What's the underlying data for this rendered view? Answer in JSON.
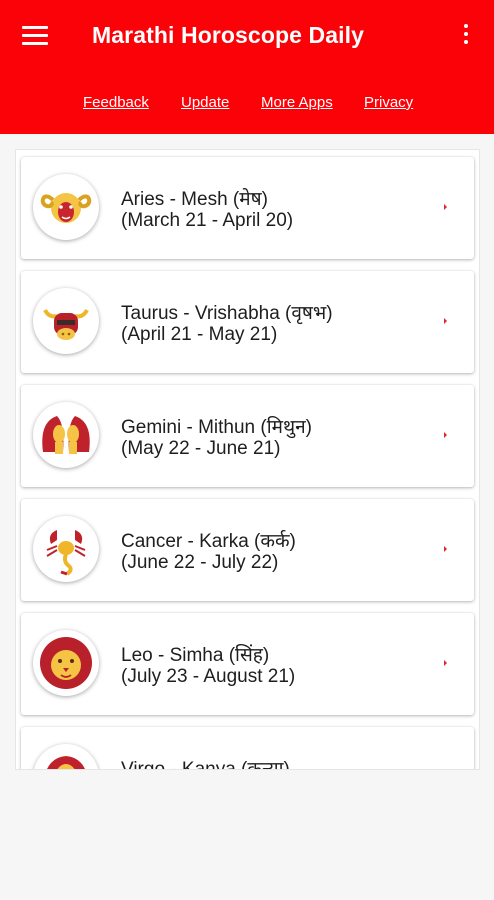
{
  "app": {
    "title": "Marathi Horoscope Daily",
    "accent_color": "#fb0208",
    "menu_icon": "hamburger-menu-icon",
    "overflow_icon": "more-vertical-icon"
  },
  "links": {
    "feedback": "Feedback",
    "update": "Update",
    "more_apps": "More Apps",
    "privacy": "Privacy"
  },
  "signs": [
    {
      "name": "Aries - Mesh (मेष)",
      "dates": "(March 21 - April 20)",
      "icon": "aries-ram-icon"
    },
    {
      "name": "Taurus - Vrishabha (वृषभ)",
      "dates": "(April 21 - May 21)",
      "icon": "taurus-bull-icon"
    },
    {
      "name": "Gemini - Mithun (मिथुन)",
      "dates": "(May 22 - June 21)",
      "icon": "gemini-twins-icon"
    },
    {
      "name": "Cancer - Karka (कर्क)",
      "dates": "(June 22 - July 22)",
      "icon": "cancer-crab-icon"
    },
    {
      "name": "Leo - Simha (सिंह)",
      "dates": "(July 23 - August 21)",
      "icon": "leo-lion-icon"
    },
    {
      "name": "Virgo - Kanya (कन्या)",
      "dates": "",
      "icon": "virgo-maiden-icon"
    }
  ]
}
